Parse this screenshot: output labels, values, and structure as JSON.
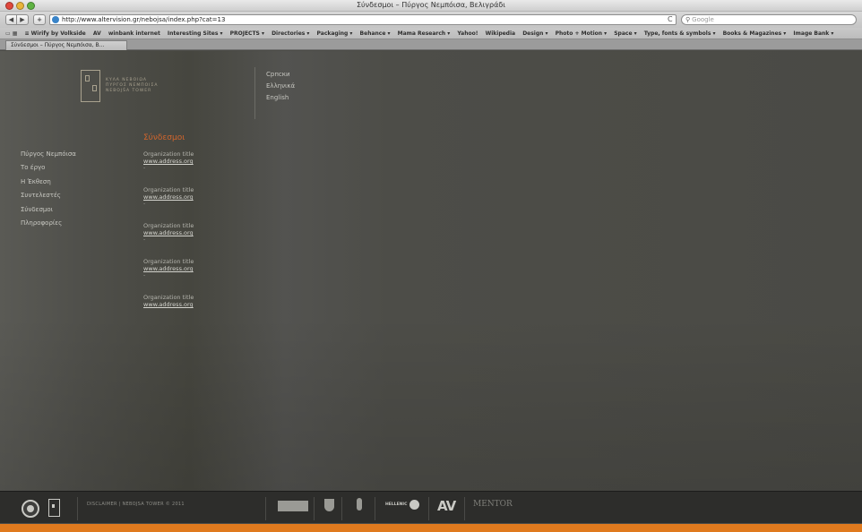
{
  "window": {
    "title": "Σύνδεσμοι – Πύργος Νεμπόισα, Βελιγράδι"
  },
  "toolbar": {
    "back_label": "◀",
    "forward_label": "▶",
    "add_label": "+",
    "url": "http://www.altervision.gr/nebojsa/index.php?cat=13",
    "reload_label": "C",
    "search_placeholder": "Google"
  },
  "bookmarks": {
    "icons": "▭ ▦",
    "items": [
      "≡ Wirify by Volkside",
      "AV",
      "winbank internet",
      "Interesting Sites ▾",
      "PROJECTS ▾",
      "Directories ▾",
      "Packaging ▾",
      "Behance ▾",
      "Mama Research ▾",
      "Yahoo!",
      "Wikipedia",
      "Design ▾",
      "Photo + Motion ▾",
      "Space ▾",
      "Type, fonts & symbols ▾",
      "Books & Magazines ▾",
      "Image Bank ▾"
    ]
  },
  "tab": {
    "label": "Σύνδεσμοι – Πύργος Νεμπόισα, Β..."
  },
  "logo": {
    "line1": "ΚΥΛΑ ΝΕΒΟΙΩΑ",
    "line2": "ΠΥΡΓΟΣ ΝΕΜΠΟΙΣΑ",
    "line3": "NEBOJŠA TOWER"
  },
  "languages": [
    "Српски",
    "Ελληνικά",
    "English"
  ],
  "section_title": "Σύνδεσμοι",
  "nav": [
    "Πύργος Νεμπόισα",
    "Το έργο",
    "Η Έκθεση",
    "Συντελεστές",
    "Σύνδεσμοι",
    "Πληροφορίες"
  ],
  "links": [
    {
      "title": "Organization title",
      "url": "www.address.org",
      "dash": "-"
    },
    {
      "title": "Organization title",
      "url": "www.address.org",
      "dash": "-"
    },
    {
      "title": "Organization title",
      "url": "www.address.org",
      "dash": "-"
    },
    {
      "title": "Organization title",
      "url": "www.address.org",
      "dash": "-"
    },
    {
      "title": "Organization title",
      "url": "www.address.org",
      "dash": ""
    }
  ],
  "footer": {
    "disclaimer": "DISCLAIMER | NEBOJSA TOWER © 2011",
    "hellenic": "HELLENIC",
    "av": "AV",
    "mentor": "MENTOR"
  },
  "colors": {
    "accent": "#d1652c",
    "footer_bar": "#e07a1e",
    "background": "#4b4b46"
  }
}
